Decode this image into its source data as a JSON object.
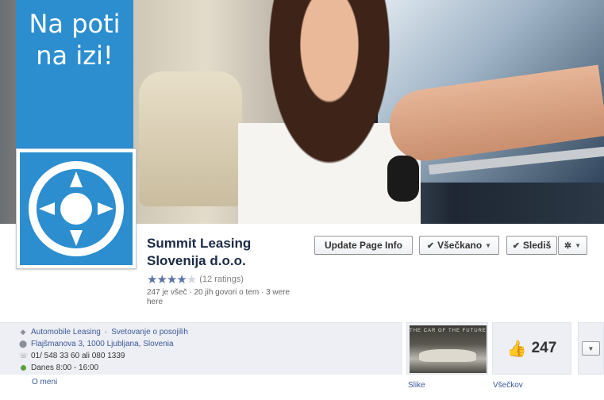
{
  "banner": {
    "line1": "Na poti",
    "line2": "na izi!"
  },
  "page": {
    "name_line1": "Summit Leasing",
    "name_line2": "Slovenija d.o.o.",
    "rating_text": "(12 ratings)",
    "rating_value": 4,
    "rating_max": 5,
    "stats_line1": "247 je všeč · 20 jih govori o tem · 3 were",
    "stats_line2": "here"
  },
  "buttons": {
    "update": "Update Page Info",
    "vsecano": "Všečkano",
    "sledis": "Slediš"
  },
  "info": {
    "category1": "Automobile Leasing",
    "separator": "·",
    "category2": "Svetovanje o posojilih",
    "address": "Flajšmanova 3, 1000 Ljubljana, Slovenia",
    "phone": "01/ 548 33 60 ali 080 1339",
    "hours": "Danes 8:00 - 16:00",
    "about": "O meni"
  },
  "tiles": {
    "photo_caption": "THE CAR OF THE FUTURE",
    "photos_label": "Slike",
    "likes_count": "247",
    "likes_label": "Všečkov"
  },
  "colors": {
    "brand_blue": "#2c8ecf",
    "link": "#3b5998",
    "open_green": "#58a13a"
  },
  "icons": [
    "compass-logo-icon",
    "tag-icon",
    "location-pin-icon",
    "phone-icon",
    "open-status-icon",
    "thumbs-up-icon",
    "check-icon",
    "gear-icon",
    "caret-down-icon"
  ]
}
